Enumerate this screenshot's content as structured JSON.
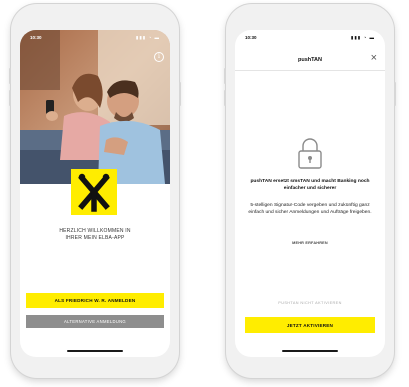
{
  "left_phone": {
    "status": {
      "time": "10:30",
      "icons": "▮▮▮ ◔ ▬"
    },
    "info_icon": "i",
    "welcome_line1": "HERZLICH WILLKOMMEN IN",
    "welcome_line2": "IHRER MEIN ELBA-APP",
    "primary_button": "ALS FRIEDRICH W. R. ANMELDEN",
    "secondary_button": "ALTERNATIVE ANMELDUNG"
  },
  "right_phone": {
    "status": {
      "time": "10:30",
      "icons": "▮▮▮ ◔ ▬"
    },
    "title": "pushTAN",
    "close": "×",
    "headline": "pushTAN ersetzt smsTAN und macht Banking noch einfacher und sicherer",
    "body": "5-stelligen Signatur-Code vergeben und zukünftig ganz einfach und sicher Anmeldungen und Aufträge freigeben.",
    "more_link": "MEHR ERFAHREN",
    "not_activate": "PUSHTAN NICHT AKTIVIEREN",
    "primary_button": "JETZT AKTIVIEREN"
  },
  "colors": {
    "brand_yellow": "#ffed00",
    "secondary_grey": "#8e8e8e"
  }
}
